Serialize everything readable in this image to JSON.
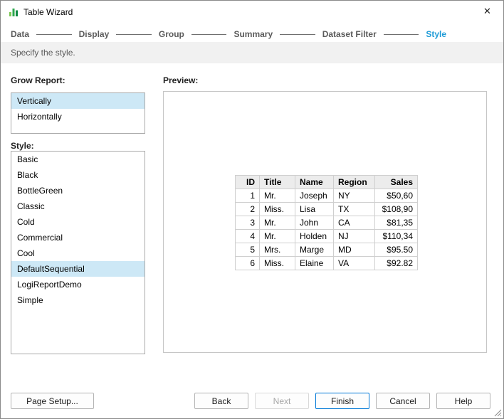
{
  "window": {
    "title": "Table Wizard"
  },
  "icons": {
    "close": "✕"
  },
  "colors": {
    "accent": "#1e9bd7",
    "selection": "#cde8f6",
    "finish_border": "#0078d7"
  },
  "steps": {
    "items": [
      {
        "label": "Data",
        "active": false
      },
      {
        "label": "Display",
        "active": false
      },
      {
        "label": "Group",
        "active": false
      },
      {
        "label": "Summary",
        "active": false
      },
      {
        "label": "Dataset Filter",
        "active": false
      },
      {
        "label": "Style",
        "active": true
      }
    ]
  },
  "subtitle": "Specify the style.",
  "grow_report": {
    "label": "Grow Report:",
    "options": [
      "Vertically",
      "Horizontally"
    ],
    "selected": "Vertically"
  },
  "style_list": {
    "label": "Style:",
    "options": [
      "Basic",
      "Black",
      "BottleGreen",
      "Classic",
      "Cold",
      "Commercial",
      "Cool",
      "DefaultSequential",
      "LogiReportDemo",
      "Simple"
    ],
    "selected": "DefaultSequential"
  },
  "preview": {
    "label": "Preview:",
    "table": {
      "headers": [
        "ID",
        "Title",
        "Name",
        "Region",
        "Sales"
      ],
      "rows": [
        [
          "1",
          "Mr.",
          "Joseph",
          "NY",
          "$50,60"
        ],
        [
          "2",
          "Miss.",
          "Lisa",
          "TX",
          "$108,90"
        ],
        [
          "3",
          "Mr.",
          "John",
          "CA",
          "$81,35"
        ],
        [
          "4",
          "Mr.",
          "Holden",
          "NJ",
          "$110,34"
        ],
        [
          "5",
          "Mrs.",
          "Marge",
          "MD",
          "$95.50"
        ],
        [
          "6",
          "Miss.",
          "Elaine",
          "VA",
          "$92.82"
        ]
      ]
    }
  },
  "buttons": {
    "page_setup": "Page Setup...",
    "back": "Back",
    "next": "Next",
    "finish": "Finish",
    "cancel": "Cancel",
    "help": "Help"
  }
}
